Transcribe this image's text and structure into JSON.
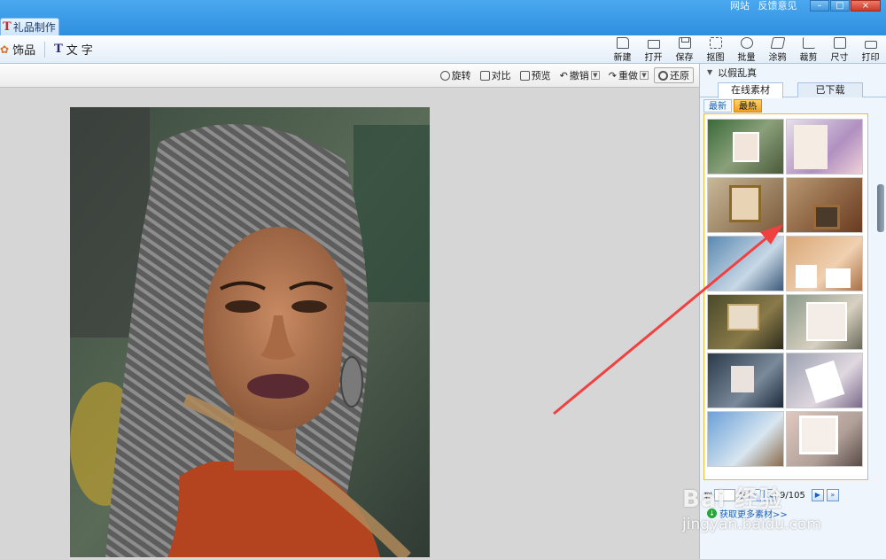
{
  "window": {
    "tab_title": "礼品制作",
    "links": [
      "网站",
      "反馈意见"
    ],
    "controls": [
      "–",
      "□",
      "×"
    ]
  },
  "toolbar": {
    "left_items": [
      {
        "label": "饰品",
        "icon": "flower-icon"
      },
      {
        "label": "文字",
        "icon": "text-T-icon"
      }
    ],
    "tools": [
      {
        "label": "新建",
        "icon": "new-file-icon"
      },
      {
        "label": "打开",
        "icon": "folder-open-icon"
      },
      {
        "label": "保存",
        "icon": "save-disk-icon"
      },
      {
        "label": "抠图",
        "icon": "cutout-icon"
      },
      {
        "label": "批量",
        "icon": "batch-gear-icon"
      },
      {
        "label": "涂鸦",
        "icon": "doodle-icon"
      },
      {
        "label": "裁剪",
        "icon": "crop-icon"
      },
      {
        "label": "尺寸",
        "icon": "resize-icon"
      },
      {
        "label": "打印",
        "icon": "printer-icon"
      }
    ]
  },
  "edit_bar": {
    "rotate": "旋转",
    "compare": "对比",
    "preview": "预览",
    "undo": "撤销",
    "redo": "重做",
    "restore": "还原"
  },
  "right_panel": {
    "header": "以假乱真",
    "tabs": [
      "在线素材",
      "已下载"
    ],
    "sub_tabs": [
      "最新",
      "最热"
    ],
    "pager": {
      "to_label": "到",
      "page_label": "页",
      "page_value": "9/105"
    },
    "more_link": "获取更多素材>>"
  },
  "watermark": {
    "line1": "Bai 经验",
    "line2": "jingyan.baidu.com"
  },
  "colors": {
    "title_bar": "#2f8fe0",
    "accent_arrow": "#f04040",
    "hot_tab": "#f0a020"
  }
}
